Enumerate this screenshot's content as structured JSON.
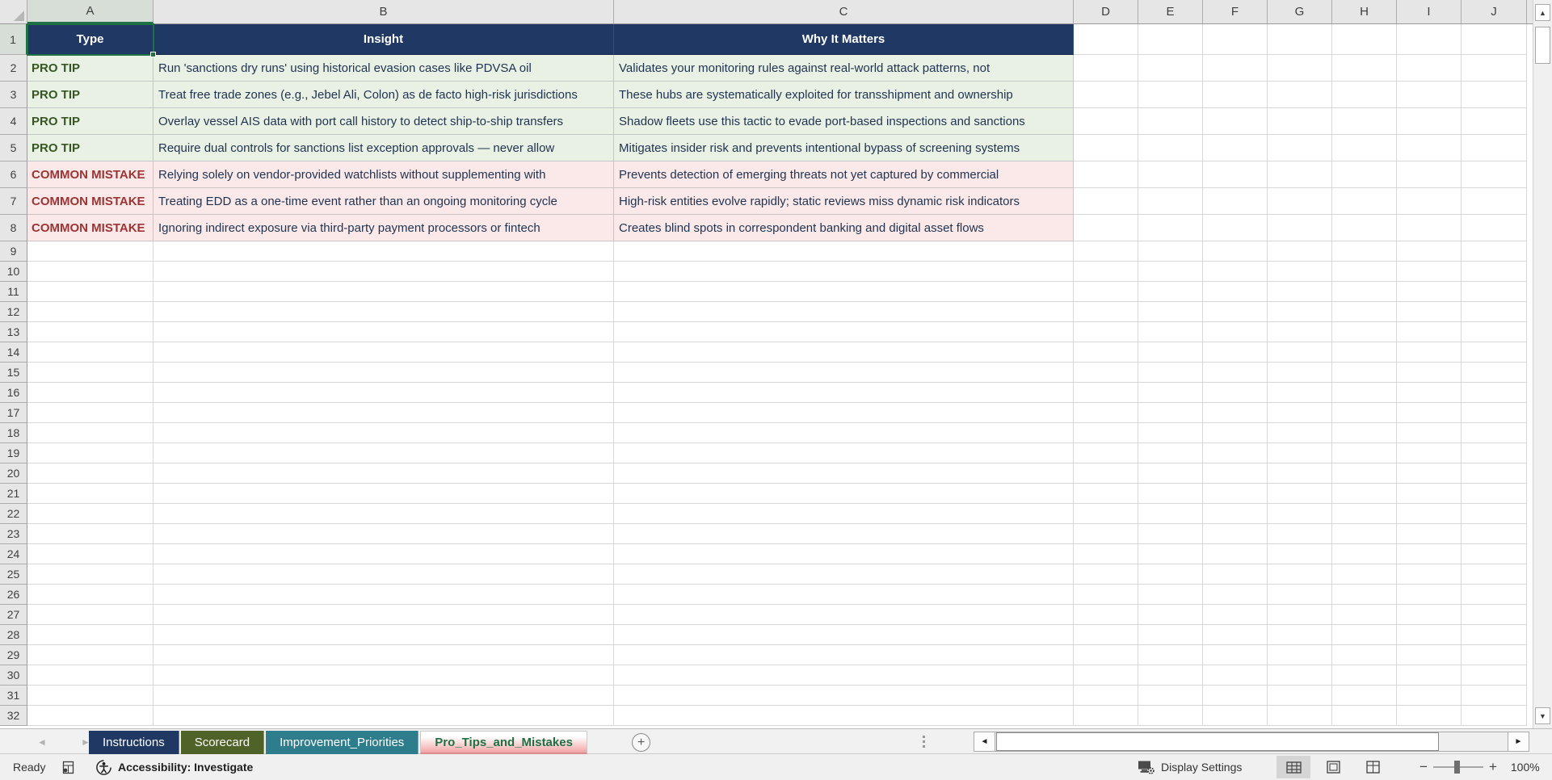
{
  "sheet": {
    "columns": [
      "A",
      "B",
      "C",
      "D",
      "E",
      "F",
      "G",
      "H",
      "I",
      "J"
    ],
    "selected_cell": "A1",
    "visible_rows": 32,
    "header_row": {
      "type": "Type",
      "insight": "Insight",
      "why": "Why It Matters"
    },
    "records": [
      {
        "kind": "tip",
        "type": "PRO TIP",
        "insight": "Run 'sanctions dry runs' using historical evasion cases like PDVSA oil",
        "why": "Validates your monitoring rules against real-world attack patterns, not"
      },
      {
        "kind": "tip",
        "type": "PRO TIP",
        "insight": "Treat free trade zones (e.g., Jebel Ali, Colon) as de facto high-risk jurisdictions",
        "why": "These hubs are systematically exploited for transshipment and ownership"
      },
      {
        "kind": "tip",
        "type": "PRO TIP",
        "insight": "Overlay vessel AIS data with port call history to detect ship-to-ship transfers",
        "why": "Shadow fleets use this tactic to evade port-based inspections and sanctions"
      },
      {
        "kind": "tip",
        "type": "PRO TIP",
        "insight": "Require dual controls for sanctions list exception approvals — never allow",
        "why": "Mitigates insider risk and prevents intentional bypass of screening systems"
      },
      {
        "kind": "mistake",
        "type": "COMMON MISTAKE",
        "insight": "Relying solely on vendor-provided watchlists without supplementing with",
        "why": "Prevents detection of emerging threats not yet captured by commercial"
      },
      {
        "kind": "mistake",
        "type": "COMMON MISTAKE",
        "insight": "Treating EDD as a one-time event rather than an ongoing monitoring cycle",
        "why": "High-risk entities evolve rapidly; static reviews miss dynamic risk indicators"
      },
      {
        "kind": "mistake",
        "type": "COMMON MISTAKE",
        "insight": "Ignoring indirect exposure via third-party payment processors or fintech",
        "why": "Creates blind spots in correspondent banking and digital asset flows"
      }
    ],
    "colors": {
      "header_bg": "#1F3864",
      "header_text": "#FFFFFF",
      "tip_bg": "#E9F1E5",
      "tip_text": "#375623",
      "mistake_bg": "#FBE9E9",
      "mistake_text": "#9C3434",
      "body_text": "#1F3350",
      "selection": "#1E7145"
    }
  },
  "tab_bar": {
    "tabs": [
      {
        "label": "Instructions",
        "color": "#1F3864",
        "text_color": "#FFFFFF",
        "active": false
      },
      {
        "label": "Scorecard",
        "color": "#4F6228",
        "text_color": "#FFFFFF",
        "active": false
      },
      {
        "label": "Improvement_Priorities",
        "color": "#2E7D8D",
        "text_color": "#FFFFFF",
        "active": false
      },
      {
        "label": "Pro_Tips_and_Mistakes",
        "color": "#F2ABAB",
        "text_color": "#1E7145",
        "active": true
      }
    ],
    "add_sheet_label": "+"
  },
  "status_bar": {
    "ready_label": "Ready",
    "accessibility_label": "Accessibility: Investigate",
    "display_settings_label": "Display Settings",
    "zoom_level": "100%"
  }
}
